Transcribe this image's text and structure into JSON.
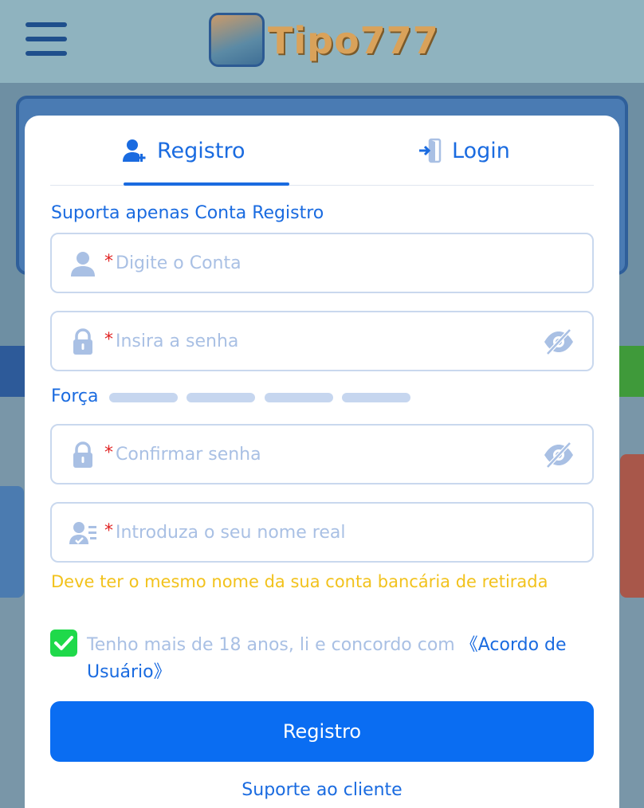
{
  "header": {
    "logo_text": "Tipo777"
  },
  "modal": {
    "tabs": [
      {
        "label": "Registro",
        "active": true
      },
      {
        "label": "Login",
        "active": false
      }
    ],
    "subtitle": "Suporta apenas Conta Registro",
    "fields": {
      "account": {
        "required_mark": "*",
        "placeholder": "Digite o Conta",
        "icon": "user-icon"
      },
      "password": {
        "required_mark": "*",
        "placeholder": "Insira a senha",
        "icon": "lock-icon"
      },
      "confirm": {
        "required_mark": "*",
        "placeholder": "Confirmar senha",
        "icon": "lock-icon"
      },
      "realname": {
        "required_mark": "*",
        "placeholder": "Introduza o seu nome real",
        "icon": "id-card-icon"
      }
    },
    "strength_label": "Força",
    "strength_level": 0,
    "realname_hint": "Deve ter o mesmo nome da sua conta bancária de retirada",
    "agreement": {
      "checked": true,
      "text": "Tenho mais de 18 anos, li e concordo com ",
      "link": "《Acordo de Usuário》"
    },
    "submit_label": "Registro",
    "support_label": "Suporte ao cliente"
  },
  "colors": {
    "accent": "#1a6be0",
    "button": "#0a6df2",
    "placeholder": "#a9c0e4",
    "hint": "#f2c21c",
    "checkbox": "#1fd94a",
    "required": "#e02424"
  }
}
